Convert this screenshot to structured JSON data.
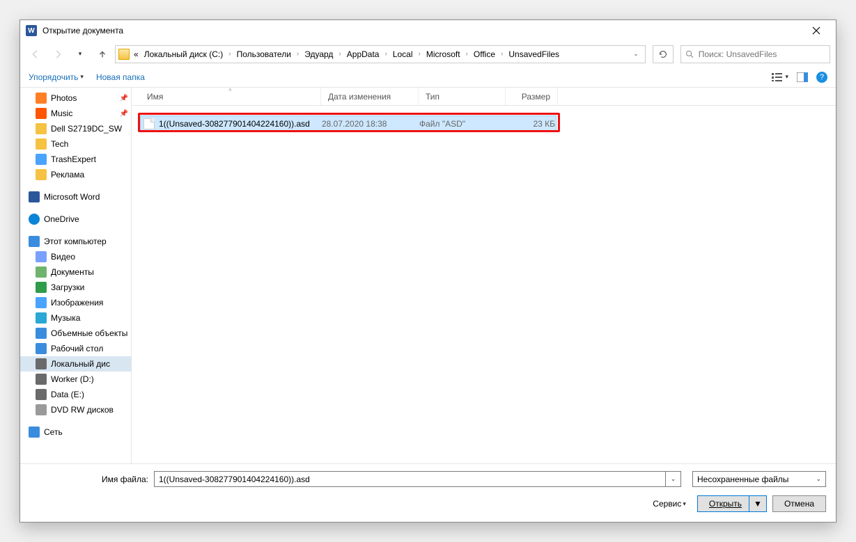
{
  "title": "Открытие документа",
  "breadcrumb": [
    "«",
    "Локальный диск (C:)",
    "Пользователи",
    "Эдуард",
    "AppData",
    "Local",
    "Microsoft",
    "Office",
    "UnsavedFiles"
  ],
  "search": {
    "placeholder": "Поиск: UnsavedFiles"
  },
  "toolbar": {
    "organize": "Упорядочить",
    "newfolder": "Новая папка"
  },
  "columns": {
    "name": "Имя",
    "date": "Дата изменения",
    "type": "Тип",
    "size": "Размер"
  },
  "file": {
    "name": "1((Unsaved-308277901404224160)).asd",
    "date": "28.07.2020 18:38",
    "type": "Файл \"ASD\"",
    "size": "23 КБ"
  },
  "sidebar": {
    "quick": [
      {
        "label": "Photos",
        "pin": true,
        "color": "#ff7f27"
      },
      {
        "label": "Music",
        "pin": true,
        "color": "#ff5500"
      },
      {
        "label": "Dell S2719DC_SW",
        "pin": false,
        "color": "#f6c244"
      },
      {
        "label": "Tech",
        "pin": false,
        "color": "#f6c244"
      },
      {
        "label": "TrashExpert",
        "pin": false,
        "color": "#4aa3ff"
      },
      {
        "label": "Реклама",
        "pin": false,
        "color": "#f6c244"
      }
    ],
    "word": "Microsoft Word",
    "onedrive": "OneDrive",
    "thispc": "Этот компьютер",
    "pcitems": [
      {
        "label": "Видео",
        "color": "#7aa0ff"
      },
      {
        "label": "Документы",
        "color": "#6fb36f"
      },
      {
        "label": "Загрузки",
        "color": "#2e9c4a"
      },
      {
        "label": "Изображения",
        "color": "#4aa3ff"
      },
      {
        "label": "Музыка",
        "color": "#2aa7d4"
      },
      {
        "label": "Объемные объекты",
        "color": "#3a8dde"
      },
      {
        "label": "Рабочий стол",
        "color": "#3a8dde"
      },
      {
        "label": "Локальный дис",
        "color": "#6a6a6a",
        "selected": true
      },
      {
        "label": "Worker (D:)",
        "color": "#6a6a6a"
      },
      {
        "label": "Data (E:)",
        "color": "#6a6a6a"
      },
      {
        "label": "DVD RW дисков",
        "color": "#9a9a9a"
      }
    ],
    "network": "Сеть"
  },
  "bottom": {
    "fnlabel": "Имя файла:",
    "fnvalue": "1((Unsaved-308277901404224160)).asd",
    "filter": "Несохраненные файлы",
    "service": "Сервис",
    "open": "Открыть",
    "cancel": "Отмена"
  }
}
